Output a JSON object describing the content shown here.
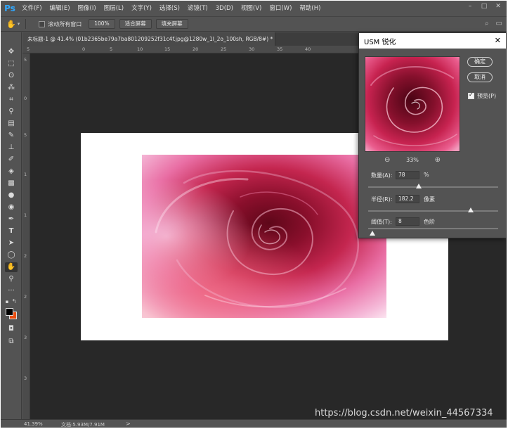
{
  "app": {
    "logo": "Ps",
    "menu": [
      "文件(F)",
      "编辑(E)",
      "图像(I)",
      "图层(L)",
      "文字(Y)",
      "选择(S)",
      "滤镜(T)",
      "3D(D)",
      "视图(V)",
      "窗口(W)",
      "帮助(H)"
    ],
    "window_controls": [
      "–",
      "□",
      "✕"
    ]
  },
  "options_bar": {
    "scroll_all_label": "滚动所有窗口",
    "scroll_all_checked": false,
    "zoom_button": "100%",
    "fit_button": "适合屏幕",
    "fill_button": "填充屏幕"
  },
  "document": {
    "tab_title": "未标题-1 @ 41.4% (01b2365be79a7ba801209252f31c4f.jpg@1280w_1l_2o_100sh, RGB/8#) *",
    "tab_close": "×",
    "ruler_h_labels": [
      "5",
      "0",
      "5",
      "10",
      "15",
      "20",
      "25",
      "30",
      "35",
      "40"
    ],
    "ruler_v_labels": [
      "5",
      "0",
      "5",
      "1",
      "1",
      "2",
      "2",
      "3",
      "3"
    ]
  },
  "dialog": {
    "title": "USM 锐化",
    "ok": "确定",
    "cancel": "取消",
    "preview_label": "预览(P)",
    "preview_checked": true,
    "zoom_level": "33%",
    "amount": {
      "label": "数量(A):",
      "value": "78",
      "unit": "%",
      "slider_fraction": 0.39
    },
    "radius": {
      "label": "半径(R):",
      "value": "182.2",
      "unit": "像素",
      "slider_fraction": 0.79
    },
    "threshold": {
      "label": "阈值(T):",
      "value": "8",
      "unit": "色阶",
      "slider_fraction": 0.03
    }
  },
  "status": {
    "zoom": "41.39%",
    "doc_size": "文档:5.93M/7.91M",
    "arrow": ">"
  },
  "watermark": "https://blog.csdn.net/weixin_44567334",
  "colors": {
    "foreground": "#000000",
    "background": "#e84d10",
    "canvas_bg": "#282828",
    "panel_bg": "#535353",
    "logo": "#31a8ff"
  },
  "tools": [
    "move-tool",
    "marquee-tool",
    "lasso-tool",
    "magic-wand-tool",
    "crop-tool",
    "eyedropper-tool",
    "healing-brush-tool",
    "brush-tool",
    "clone-stamp-tool",
    "history-brush-tool",
    "eraser-tool",
    "gradient-tool",
    "blur-tool",
    "dodge-tool",
    "pen-tool",
    "type-tool",
    "path-selection-tool",
    "ellipse-tool",
    "hand-tool",
    "zoom-tool",
    "more-tools",
    "default-colors",
    "swap-colors",
    "quick-mask",
    "screen-mode"
  ]
}
